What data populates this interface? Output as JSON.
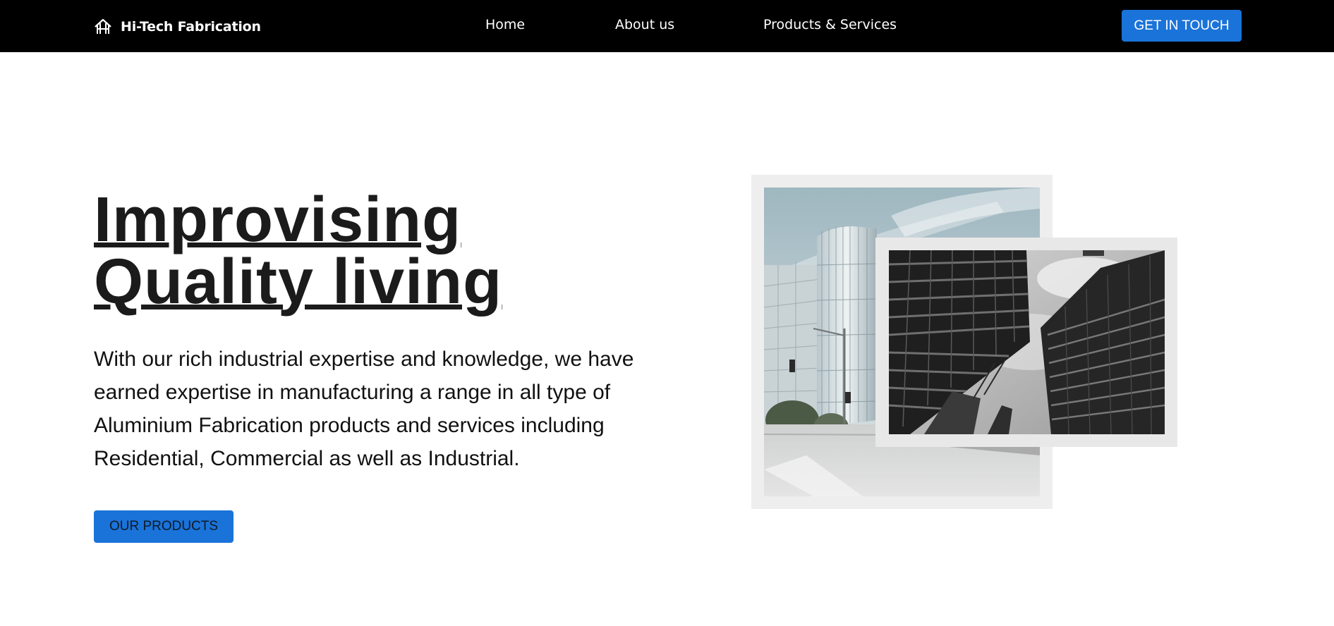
{
  "brand": {
    "name": "Hi-Tech Fabrication",
    "icon": "house-logo-icon"
  },
  "nav": {
    "links": [
      {
        "label": "Home"
      },
      {
        "label": "About us"
      },
      {
        "label": "Products & Services"
      }
    ],
    "cta_label": "GET IN TOUCH"
  },
  "hero": {
    "title_line1": "Improvising",
    "title_line2": "Quality living",
    "description": "With our rich industrial expertise and knowledge, we have earned expertise in manufacturing a range in all type of Aluminium Fabrication products and services including Residential, Commercial as well as Industrial.",
    "cta_label": "OUR PRODUCTS"
  },
  "colors": {
    "navbar_bg": "#000000",
    "accent": "#1a73d9",
    "heading": "#1b1b1b",
    "frame": "#efeeee"
  }
}
